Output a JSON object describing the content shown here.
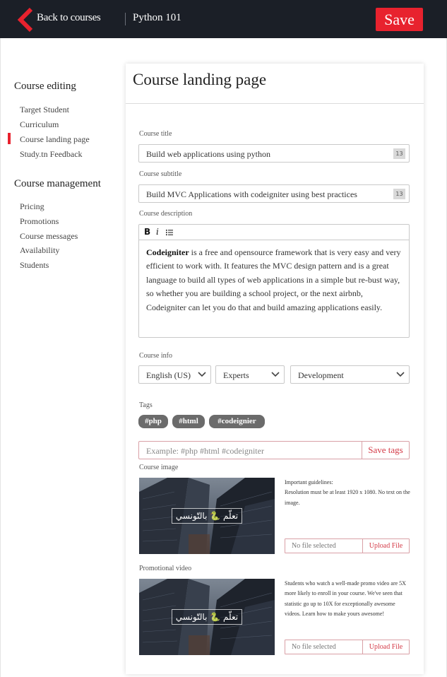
{
  "header": {
    "back_label": "Back to courses",
    "course_name": "Python 101",
    "save_label": "Save",
    "accent_color": "#e8222e"
  },
  "sidebar": {
    "editing_heading": "Course editing",
    "editing_items": [
      {
        "label": "Target Student"
      },
      {
        "label": "Curriculum"
      },
      {
        "label": "Course landing page",
        "active": true
      },
      {
        "label": "Study.tn Feedback"
      }
    ],
    "management_heading": "Course management",
    "management_items": [
      {
        "label": "Pricing"
      },
      {
        "label": "Promotions"
      },
      {
        "label": "Course messages"
      },
      {
        "label": "Availability"
      },
      {
        "label": "Students"
      }
    ]
  },
  "main": {
    "title": "Course landing page",
    "course_title": {
      "label": "Course title",
      "value": "Build web applications using python",
      "counter": "13"
    },
    "course_subtitle": {
      "label": "Course subtitle",
      "value": "Build MVC Applications with codeigniter using best practices",
      "counter": "13"
    },
    "description": {
      "label": "Course description",
      "toolbar": {
        "bold": "B",
        "italic": "i",
        "list_icon": "list-icon"
      },
      "bold_lead": "Codeigniter",
      "text": " is a free and opensource framework that is very easy and very efficient to work with. It features the MVC design pattern and is a great language to build all types of web applications in a simple but re-bust way, so whether you are building a school project, or the next airbnb, Codeigniter can let you do that and build amazing applications easily."
    },
    "course_info": {
      "label": "Course info",
      "language": "English (US)",
      "level": "Experts",
      "category": "Development"
    },
    "tags": {
      "label": "Tags",
      "items": [
        "#php",
        "#html",
        "#codeignier"
      ],
      "placeholder": "Example: #php #html #codeigniter",
      "save_label": "Save tags"
    },
    "course_image": {
      "label": "Course image",
      "badge_text": "تعلّم 🐍 بالتّونسي",
      "guidelines": "Important guidelines:\nResolution must be at least 1920  x 1080. No text on the image.",
      "file_status": "No file selected",
      "upload_label": "Upload File"
    },
    "promo_video": {
      "label": "Promotional video",
      "badge_text": "تعلّم 🐍 بالتّونسي",
      "guidelines": "Students who watch a well-made promo video are 5X more likely to enroll in your course. We've seen that statistic go up to 10X for exceptionally awesome videos. Learn how to make yours awesome!",
      "file_status": "No file selected",
      "upload_label": "Upload File"
    }
  }
}
